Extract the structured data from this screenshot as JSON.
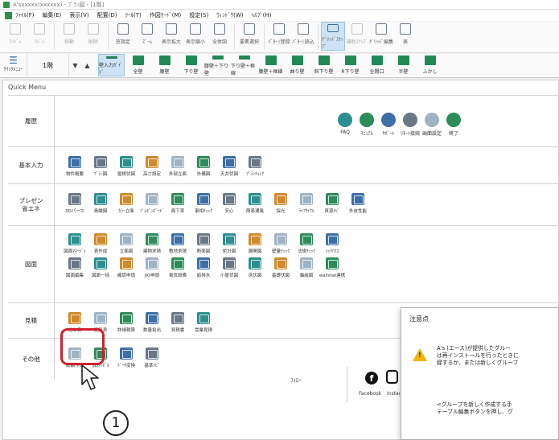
{
  "window": {
    "title": "A'sxxxxx(xxxxxx) - ﾌﾟﾗﾝ図 - [1階]"
  },
  "menubar": [
    "ﾌｧｲﾙ(F)",
    "編集(E)",
    "表示(V)",
    "配置(D)",
    "ﾂｰﾙ(T)",
    "作図ﾓｰﾄﾞ(M)",
    "設定(S)",
    "ｳｨﾝﾄﾞｳ(W)",
    "ﾍﾙﾌﾟ(H)"
  ],
  "toolbar": [
    {
      "label": "ｱﾝﾄﾞｩ",
      "dim": true
    },
    {
      "label": "ﾘﾄﾞｩ",
      "dim": true
    },
    {
      "label": "移動",
      "dim": true
    },
    {
      "label": "削除",
      "dim": true
    },
    {
      "label": "窓指定",
      "dim": false
    },
    {
      "label": "ｽﾞｰﾑ",
      "dim": false
    },
    {
      "label": "表示拡大",
      "dim": false
    },
    {
      "label": "表示縮小",
      "dim": false
    },
    {
      "label": "全体図",
      "dim": false
    },
    {
      "label": "要素選択",
      "dim": false
    },
    {
      "label": "ﾊﾟﾀｰﾝ登録",
      "dim": false
    },
    {
      "label": "ﾊﾟﾀｰﾝ読込",
      "dim": false
    },
    {
      "label": "ｸﾞﾘｯﾄﾞｽﾅｯﾌﾟ",
      "dim": false,
      "selected": true
    },
    {
      "label": "補助ｽﾅｯﾌﾟ",
      "dim": true
    },
    {
      "label": "ｸﾞﾘｯﾄﾞ編集",
      "dim": false
    },
    {
      "label": "表",
      "dim": false
    }
  ],
  "toolbar2": {
    "quickmenu_label": "ｸｲｯｸﾒﾆｭｰ",
    "floor": "1階",
    "walls": [
      "壁入力ｶﾞｲﾄﾞ",
      "全壁",
      "腰壁",
      "下り壁",
      "腰壁＋下り壁",
      "下り壁＋框線",
      "腰壁＋框線",
      "曲り壁",
      "斜下り壁",
      "R下り壁",
      "全開口",
      "半壁",
      "ふかし"
    ]
  },
  "quick_menu": {
    "title": "Quick Menu",
    "rows": [
      {
        "label": "履歴",
        "items": []
      },
      {
        "label": "基本入力",
        "items": [
          "物件概要",
          "ﾌﾟﾗﾝ図",
          "屋根伏図",
          "高さ設定",
          "外部立面",
          "外構図",
          "天井伏図",
          "ﾌﾟﾗﾝﾁｪｯｸ"
        ]
      },
      {
        "label": "プレゼン\n省エネ",
        "items": [
          "3Dパース",
          "鳥瞰図",
          "ｶﾗｰ立面",
          "ﾌﾟﾚｾﾞﾝﾎﾞｰﾄﾞ",
          "面下率",
          "事相ﾁｪｯｸ",
          "安心",
          "簡易通風",
          "採光",
          "ﾗｲﾌｻｲｸﾙ",
          "資源ﾅﾋﾞ",
          "外皮性能"
        ]
      },
      {
        "label": "図面",
        "items": [
          "図面ﾏﾈｰｼﾞｬ",
          "表作成",
          "立面図",
          "建物求積",
          "敷地求積",
          "断面図",
          "矩計図",
          "展開図",
          "壁量ﾁｪｯｸ",
          "法規ﾁｪｯｸ",
          "ｼｯｸﾊｳｽ",
          "図面編集",
          "図面一括",
          "確認申請",
          "JIO申請",
          "電気設備",
          "給排水",
          "小屋伏図",
          "床伏図",
          "基礎伏図",
          "軸組図",
          "wallstat連携"
        ]
      },
      {
        "label": "見積",
        "items": [
          "仕上表",
          "建具表",
          "詳細積算",
          "数量拾出",
          "見積書",
          "営業見積"
        ]
      },
      {
        "label": "その他",
        "items": [
          "部品作成",
          "3Dｼﾝﾎﾞﾙ",
          "ﾃﾞｰﾀ変換",
          "基準ﾅﾋﾞ"
        ]
      }
    ],
    "support": [
      "FAQ",
      "ﾏﾆｭｱﾙ",
      "ｻﾎﾟｰﾄ",
      "ﾘﾓｰﾄ接続",
      "画面設定",
      "終了"
    ],
    "follow_label": "ﾌｫﾛｰ",
    "facebook_label": "Facebook",
    "instagram_label": "Instagram"
  },
  "dialog": {
    "title": "注意点",
    "text_lines": [
      "A's (エース)が提供したグルー",
      "は再インストールを行ったときに",
      "録するか、または新しくグルーフ"
    ],
    "text2_lines": [
      "<グループを新しく作成する手",
      "テーブル編集ボタンを押し、グ"
    ]
  },
  "callout": {
    "number": "1"
  }
}
